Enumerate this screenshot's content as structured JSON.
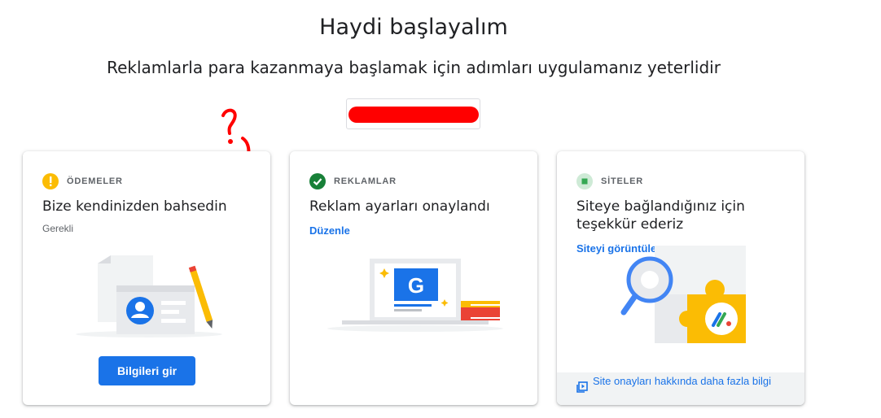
{
  "header": {
    "title": "Haydi başlayalım",
    "subtitle": "Reklamlarla para kazanmaya başlamak için adımları uygulamanız yeterlidir"
  },
  "cards": [
    {
      "category": "ÖDEMELER",
      "title": "Bize kendinizden bahsedin",
      "status": "Gerekli",
      "button": "Bilgileri gir",
      "status_color": "#fbbc04"
    },
    {
      "category": "REKLAMLAR",
      "title": "Reklam ayarları onaylandı",
      "link": "Düzenle",
      "status_color": "#188038",
      "illustration_letter": "G"
    },
    {
      "category": "SİTELER",
      "title": "Siteye bağlandığınız için teşekkür ederiz",
      "link": "Siteyi görüntüle",
      "learn_more": "Site onayları hakkında daha fazla bilgi",
      "status_color": "#34a853"
    }
  ],
  "colors": {
    "accent": "#1a73e8",
    "annotation": "#ff0000"
  }
}
